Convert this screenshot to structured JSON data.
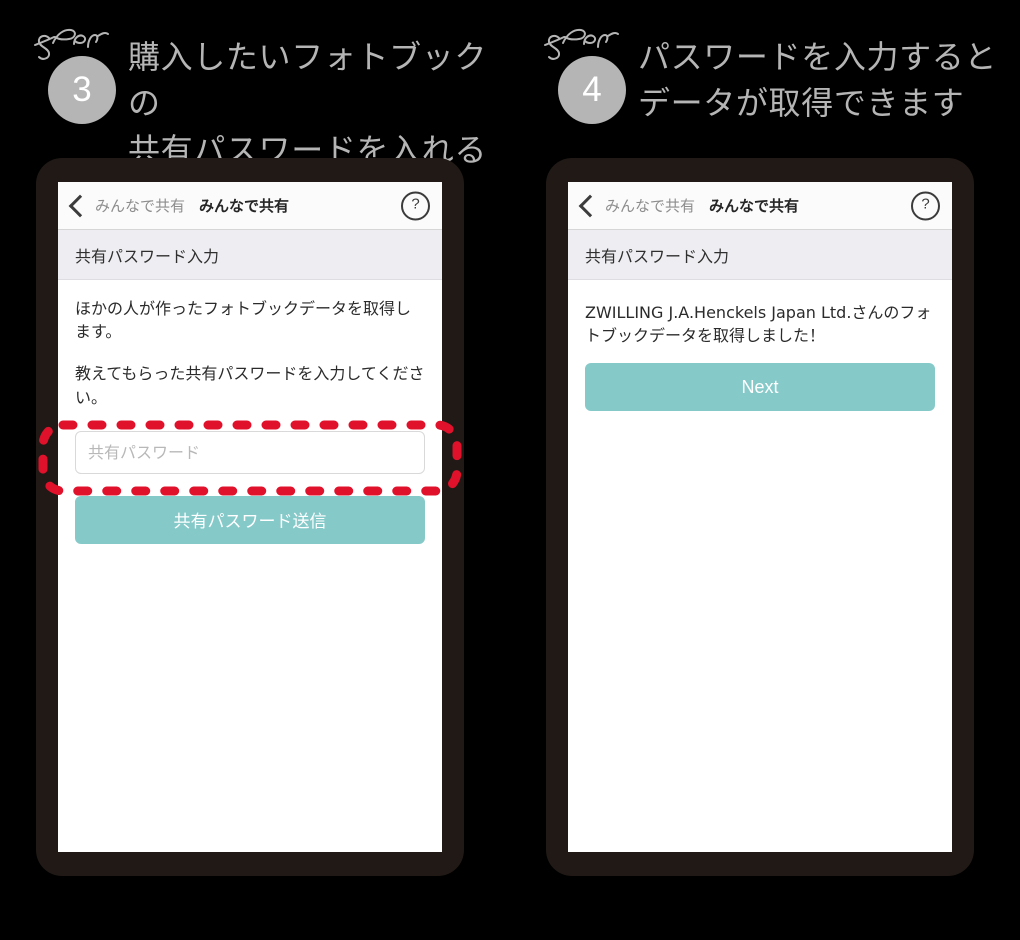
{
  "steps": [
    {
      "script_label": "Step",
      "number": "3",
      "title": "購入したいフォトブックの\n共有パスワードを入れる"
    },
    {
      "script_label": "Step",
      "number": "4",
      "title": "パスワードを入力すると\nデータが取得できます"
    }
  ],
  "colors": {
    "badge": "#b5b5b5",
    "heading": "#b5b5b5",
    "phone_frame": "#211915",
    "accent_button": "#86c9c9",
    "highlight": "#e0112b",
    "subheader_bg": "#eeeef2",
    "background": "#000000"
  },
  "phone_left": {
    "navbar": {
      "back_label": "みんなで共有",
      "title": "みんなで共有",
      "help_glyph": "?"
    },
    "subheader": "共有パスワード入力",
    "body": {
      "paragraph_1": "ほかの人が作ったフォトブックデータを取得します。",
      "paragraph_2": "教えてもらった共有パスワードを入力してください。"
    },
    "password_input": {
      "placeholder": "共有パスワード",
      "value": ""
    },
    "submit_button": "共有パスワード送信"
  },
  "phone_right": {
    "navbar": {
      "back_label": "みんなで共有",
      "title": "みんなで共有",
      "help_glyph": "?"
    },
    "subheader": "共有パスワード入力",
    "body": {
      "result_message": "ZWILLING J.A.Henckels Japan Ltd.さんのフォトブックデータを取得しました！"
    },
    "next_button": "Next"
  }
}
